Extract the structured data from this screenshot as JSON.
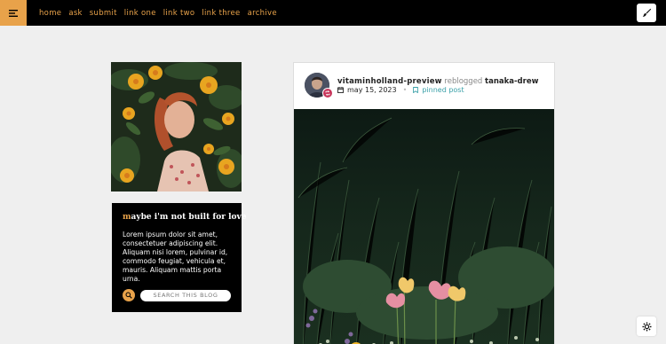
{
  "topbar": {
    "menu_icon": "menu-lines-icon",
    "nav": [
      {
        "label": "home"
      },
      {
        "label": "ask"
      },
      {
        "label": "submit"
      },
      {
        "label": "link one"
      },
      {
        "label": "link two"
      },
      {
        "label": "link three"
      },
      {
        "label": "archive"
      }
    ],
    "tool_icon": "paintbrush-icon"
  },
  "sidebar": {
    "title_first": "m",
    "title_rest": "aybe i'm not built for love",
    "description": "Lorem ipsum dolor sit amet, consectetuer adipiscing elit. Aliquam nisi lorem, pulvinar id, commodo feugiat, vehicula et, mauris. Aliquam mattis porta urna.",
    "search_placeholder": "SEARCH THIS BLOG",
    "search_icon": "search-icon"
  },
  "post": {
    "username": "vitaminholland-preview",
    "reblogged_text": "reblogged",
    "source": "tanaka-drew",
    "date": "may 15, 2023",
    "pinned": "pinned post"
  },
  "colors": {
    "accent": "#e8a24a",
    "topbar_bg": "#000000",
    "page_bg": "#efefef",
    "pinned": "#3aa0a8",
    "reblog_badge": "#c7345a"
  }
}
